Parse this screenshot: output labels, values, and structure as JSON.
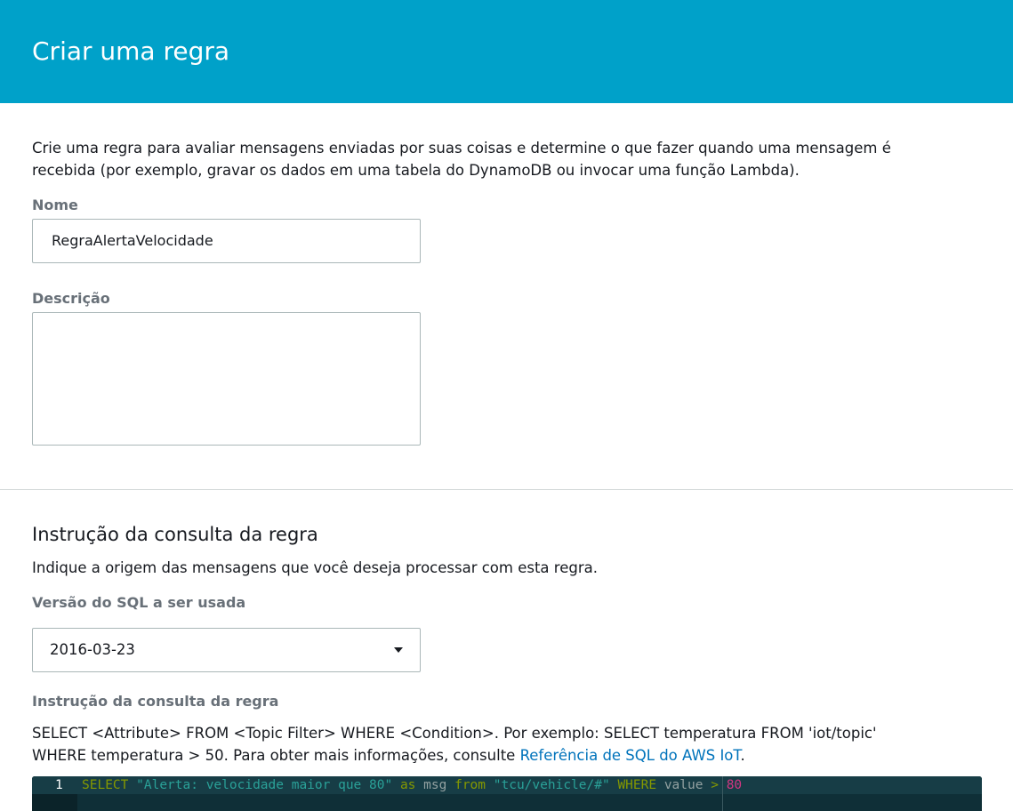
{
  "header": {
    "title": "Criar uma regra"
  },
  "intro": "Crie uma regra para avaliar mensagens enviadas por suas coisas e determine o que fazer quando uma mensagem é recebida (por exemplo, gravar os dados em uma tabela do DynamoDB ou invocar uma função Lambda).",
  "form": {
    "name_label": "Nome",
    "name_value": "RegraAlertaVelocidade",
    "description_label": "Descrição",
    "description_value": ""
  },
  "query_section": {
    "title": "Instrução da consulta da regra",
    "description": "Indique a origem das mensagens que você deseja processar com esta regra.",
    "sql_version_label": "Versão do SQL a ser usada",
    "sql_version_value": "2016-03-23",
    "statement_label": "Instrução da consulta da regra",
    "help_text": "SELECT <Attribute> FROM <Topic Filter> WHERE <Condition>. Por exemplo: SELECT temperatura FROM 'iot/topic' WHERE temperatura > 50. Para obter mais informações, consulte ",
    "help_link": "Referência de SQL do AWS IoT",
    "help_suffix": "."
  },
  "editor": {
    "line_number": "1",
    "tokens": {
      "select": "SELECT",
      "alert_string": "\"Alerta: velocidade maior que 80\"",
      "as": "as",
      "alias": "msg",
      "from": "from",
      "topic": "\"tcu/vehicle/#\"",
      "where": "WHERE",
      "field": "value",
      "operator": ">",
      "number": "80"
    }
  },
  "colors": {
    "header_bg": "#00a1c9",
    "link": "#0073bb",
    "editor_bg": "#0f2f37"
  }
}
